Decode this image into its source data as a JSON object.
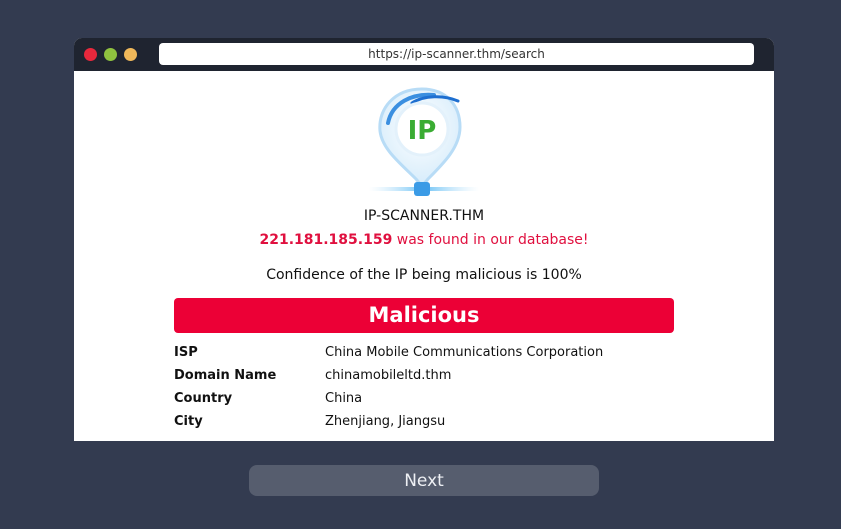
{
  "browser": {
    "url": "https://ip-scanner.thm/search",
    "window_dots": [
      "close",
      "maximize",
      "minimize"
    ]
  },
  "logo": {
    "text": "IP",
    "icon": "location-pin-ip-logo"
  },
  "brand_name": "IP-SCANNER.THM",
  "result": {
    "ip": "221.181.185.159",
    "found_text": " was found in our database!",
    "confidence_text": "Confidence of the IP being malicious is 100%",
    "verdict": "Malicious"
  },
  "details": [
    {
      "label": "ISP",
      "value": "China Mobile Communications Corporation"
    },
    {
      "label": "Domain Name",
      "value": "chinamobileltd.thm"
    },
    {
      "label": "Country",
      "value": "China"
    },
    {
      "label": "City",
      "value": "Zhenjiang, Jiangsu"
    }
  ],
  "next_label": "Next",
  "colors": {
    "background": "#333b50",
    "titlebar": "#1f2430",
    "verdict": "#ec0036",
    "found_text": "#e0103f",
    "next_button": "#565d6e"
  }
}
